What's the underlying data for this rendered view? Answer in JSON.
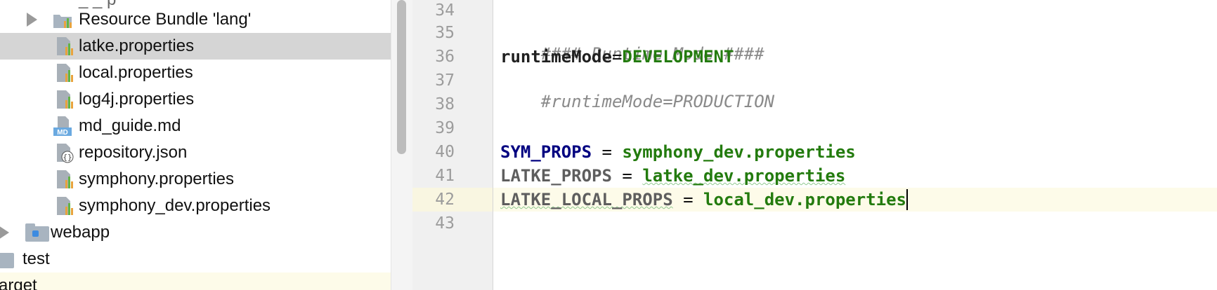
{
  "tree": {
    "items": [
      {
        "label": "_ _ p",
        "kind": "clipped"
      },
      {
        "label": "Resource Bundle 'lang'",
        "kind": "bundle"
      },
      {
        "label": "latke.properties",
        "kind": "properties",
        "selected": true
      },
      {
        "label": "local.properties",
        "kind": "properties"
      },
      {
        "label": "log4j.properties",
        "kind": "properties"
      },
      {
        "label": "md_guide.md",
        "kind": "markdown"
      },
      {
        "label": "repository.json",
        "kind": "json"
      },
      {
        "label": "symphony.properties",
        "kind": "properties"
      },
      {
        "label": "symphony_dev.properties",
        "kind": "properties"
      },
      {
        "label": "webapp",
        "kind": "folder"
      },
      {
        "label": "test",
        "kind": "folder"
      },
      {
        "label": "arget",
        "kind": "folder"
      }
    ],
    "icons": {
      "properties": "properties-file-icon",
      "markdown": "markdown-file-icon",
      "json": "json-file-icon",
      "bundle": "resource-bundle-icon",
      "folder": "folder-icon"
    },
    "md_badge": "MD",
    "json_badge": "{}"
  },
  "editor": {
    "line_numbers": [
      "34",
      "35",
      "36",
      "37",
      "38",
      "39",
      "40",
      "41",
      "42",
      "43"
    ],
    "current_line": "42",
    "lines": {
      "l35": "#### Runtime Mode ####",
      "l36_key": "runtimeMode",
      "l36_eq": "=",
      "l36_val": "DEVELOPMENT",
      "l37": "#runtimeMode=PRODUCTION",
      "l40_key": "SYM_PROPS",
      "l40_eq": " = ",
      "l40_val": "symphony_dev.properties",
      "l41_key": "LATKE_PROPS",
      "l41_eq": " = ",
      "l41_val": "latke_dev.properties",
      "l42_key": "LATKE_LOCAL_PROPS",
      "l42_eq": " = ",
      "l42_val": "local_dev.properties"
    },
    "colors": {
      "comment": "#8a8a8a",
      "value": "#237b0e",
      "current_line_bg": "#fdfbe9",
      "selection_bg": "#d5d5d5"
    }
  }
}
